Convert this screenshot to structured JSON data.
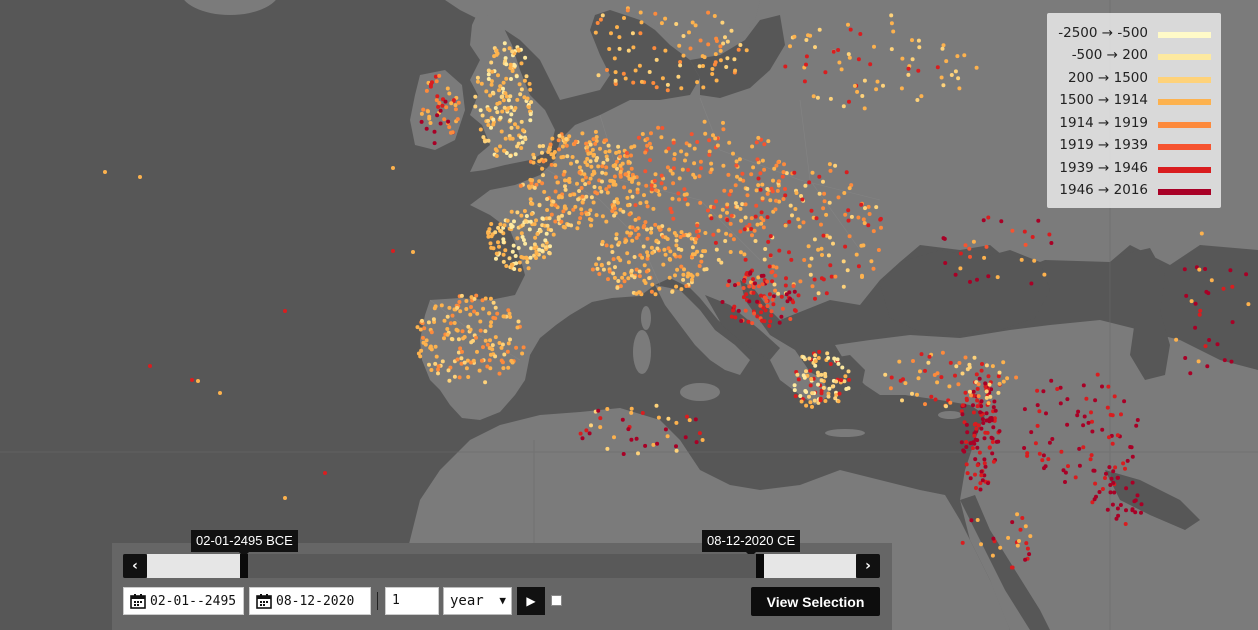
{
  "map": {
    "background_color": "#575757",
    "land_color": "#7b7b7b",
    "border_color": "#888888"
  },
  "legend": {
    "items": [
      {
        "label": "-2500 → -500",
        "color": "#fffac8"
      },
      {
        "label": "-500 → 200",
        "color": "#fde9a0"
      },
      {
        "label": "200 → 1500",
        "color": "#fed27a"
      },
      {
        "label": "1500 → 1914",
        "color": "#fdb24e"
      },
      {
        "label": "1914 → 1919",
        "color": "#fd8a3c"
      },
      {
        "label": "1919 → 1939",
        "color": "#f65430"
      },
      {
        "label": "1939 → 1946",
        "color": "#d91d1f"
      },
      {
        "label": "1946 → 2016",
        "color": "#a80026"
      }
    ]
  },
  "timeline": {
    "start_tooltip": "02-01-2495 BCE",
    "end_tooltip": "08-12-2020 CE",
    "prev_icon": "chevron-left-icon",
    "next_icon": "chevron-right-icon",
    "start_input": "02-01--2495",
    "end_input": "08-12-2020",
    "step_value": "1",
    "step_unit": "year",
    "unit_options": [
      "year"
    ],
    "play_icon": "play-icon",
    "view_button": "View Selection"
  }
}
